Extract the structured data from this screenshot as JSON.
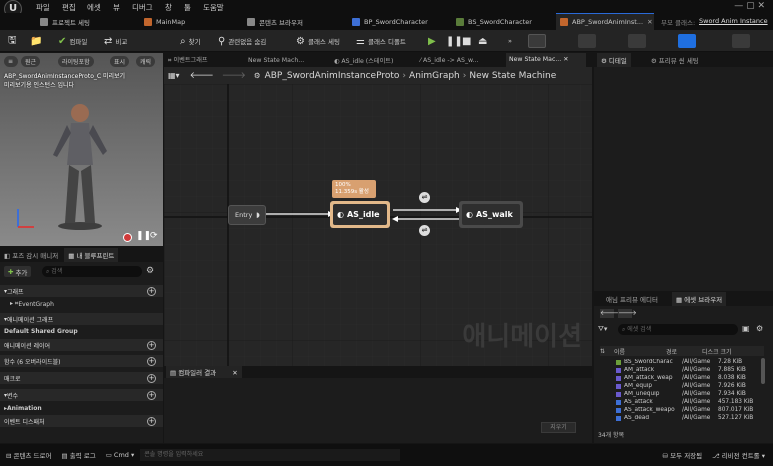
{
  "menu": [
    "파일",
    "편집",
    "에셋",
    "뷰",
    "디버그",
    "창",
    "툴",
    "도움말"
  ],
  "tabs": [
    {
      "label": "프로젝트 세팅",
      "color": "#888888"
    },
    {
      "label": "MainMap",
      "color": "#c2662d"
    },
    {
      "label": "콘텐츠 브라우저",
      "color": "#888888"
    },
    {
      "label": "BP_SwordCharacter",
      "color": "#3d6fd6"
    },
    {
      "label": "BS_SwordCharacter",
      "color": "#5a7c3a"
    },
    {
      "label": "ABP_SwordAnimInst...",
      "color": "#c2662d"
    }
  ],
  "tab_right": {
    "label1": "부모 클래스:",
    "label2": "Sword Anim Instance"
  },
  "toolbar": {
    "compile": "컴파일",
    "diff": "비교",
    "search": "찾기",
    "hide_unrelated": "관련없음 숨김",
    "class_settings": "클래스 세팅",
    "class_defaults": "클래스 디폴트",
    "arrows": "»"
  },
  "viewport": {
    "btn_perspective": "원근",
    "btn_lit": "라이팅포함",
    "btn_show": "표시",
    "btn_char": "캐릭",
    "overlay_line1": "ABP_SwordAnimInstanceProto_C 미리보기",
    "overlay_line2": "미리보기용 인스턴스 입니다"
  },
  "left_tabs": {
    "pose_watch": "포즈 감시 매니저",
    "my_blueprint": "내 블루프린트"
  },
  "bp": {
    "add": "추가",
    "search_placeholder": "검색",
    "cat_graph": "그래프",
    "event_graph": "EventGraph",
    "cat_anim_graph": "애니메이션 그래프",
    "default_shared": "Default Shared Group",
    "anim_layer": "애니메이션 레이어",
    "functions": "함수 (6 오버라이드블)",
    "macros": "매크로",
    "variables": "변수",
    "animation": "Animation",
    "event_dispatch": "이벤트 디스패처"
  },
  "graph_tabs": [
    "이벤트그래프",
    "New State Mach...",
    "AS_idle (스테이트)",
    "AS_idle -> AS_w...",
    "New State Mac..."
  ],
  "breadcrumb": {
    "root": "ABP_SwordAnimInstanceProto",
    "sep": "›",
    "a": "AnimGraph",
    "b": "New State Machine"
  },
  "nodes": {
    "entry": "Entry",
    "idle": "AS_idle",
    "walk": "AS_walk",
    "tip_pct": "100%",
    "tip_active": "11.359s 활성"
  },
  "watermark": "애니메이션",
  "compile_tab": "컴파일러 결과",
  "compile_clear": "지우기",
  "right": {
    "details": "디테일",
    "preview_settings": "프리뷰 씬 세팅"
  },
  "asset": {
    "tab_anim_editor": "애님 프리뷰 에디터",
    "tab_asset_browser": "에셋 브라우저",
    "search_placeholder": "에셋 검색",
    "col_name": "이름",
    "col_path": "경로",
    "col_size": "디스크 크기",
    "rows": [
      {
        "name": "BS_SwordCharac",
        "path": "/All/Game",
        "size": "7.28 KiB",
        "color": "#6b9e3a"
      },
      {
        "name": "AM_attack",
        "path": "/All/Game",
        "size": "7.885 KiB",
        "color": "#6a5acd"
      },
      {
        "name": "AM_attack_weap",
        "path": "/All/Game",
        "size": "8.038 KiB",
        "color": "#6a5acd"
      },
      {
        "name": "AM_equip",
        "path": "/All/Game",
        "size": "7.926 KiB",
        "color": "#6a5acd"
      },
      {
        "name": "AM_unequip",
        "path": "/All/Game",
        "size": "7.934 KiB",
        "color": "#6a5acd"
      },
      {
        "name": "AS_attack",
        "path": "/All/Game",
        "size": "457.183 KiB",
        "color": "#3d6fd6"
      },
      {
        "name": "AS_attack_weapo",
        "path": "/All/Game",
        "size": "807.017 KiB",
        "color": "#3d6fd6"
      },
      {
        "name": "AS_dead",
        "path": "/All/Game",
        "size": "527.127 KiB",
        "color": "#3d6fd6"
      }
    ],
    "count": "34개 항목"
  },
  "status": {
    "content_drawer": "콘텐츠 드로어",
    "output_log": "출력 로그",
    "cmd": "Cmd",
    "cmd_placeholder": "콘솔 명령을 입력하세요",
    "save_all": "모두 저장됨",
    "revision": "리비전 컨트롤"
  }
}
